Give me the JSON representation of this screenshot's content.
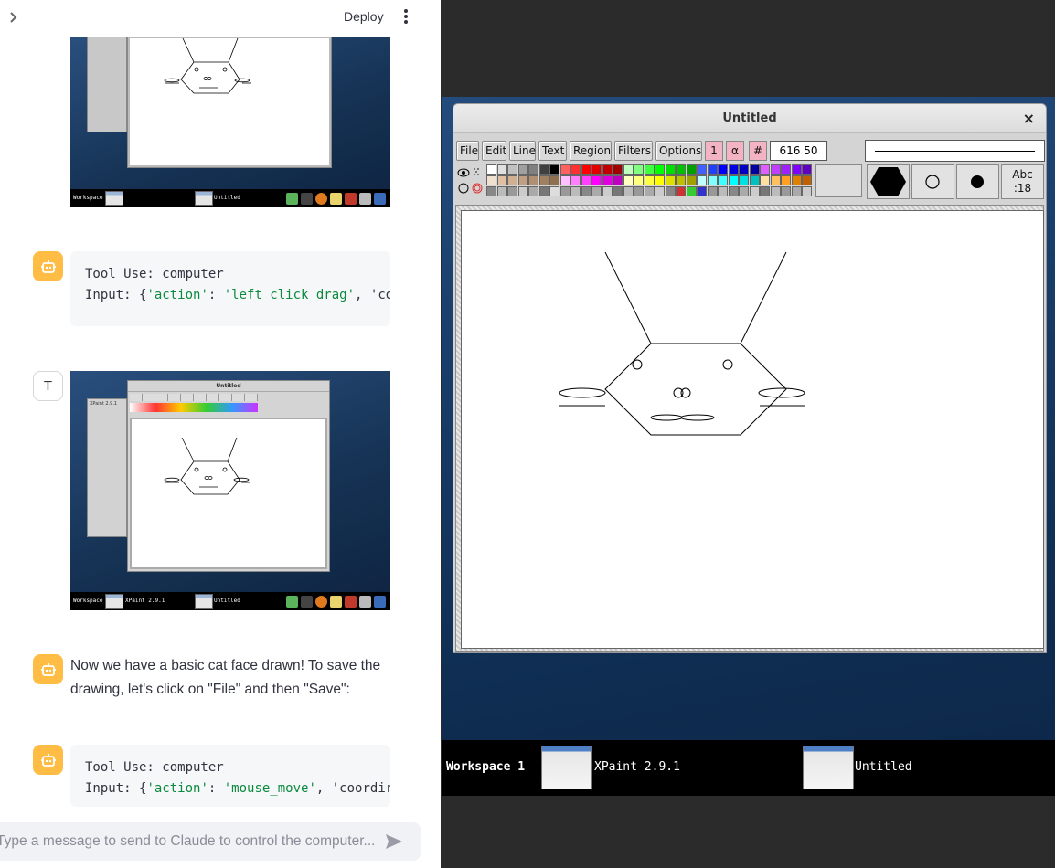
{
  "header": {
    "deploy_label": "Deploy"
  },
  "chat": {
    "tool_use_1": {
      "line1": "Tool Use: computer",
      "line2_prefix": "Input: {",
      "line2_key": "'action'",
      "line2_sep": ": ",
      "line2_val": "'left_click_drag'",
      "line2_rest": ", 'co"
    },
    "user_avatar": "T",
    "message_1": "Now we have a basic cat face drawn! To save the drawing, let's click on \"File\" and then \"Save\":",
    "tool_use_2": {
      "line1": "Tool Use: computer",
      "line2_prefix": "Input: {",
      "line2_key": "'action'",
      "line2_sep": ": ",
      "line2_val": "'mouse_move'",
      "line2_rest": ", 'coordir"
    },
    "input_placeholder": "Type a message to send to Claude to control the computer..."
  },
  "thumb_shots": {
    "taskbar_workspace": "Workspace 1",
    "taskbar_app": "XPaint 2.9.1",
    "taskbar_window": "Untitled",
    "mini_title": "Untitled",
    "mini_app": "XPaint 2.9.1"
  },
  "xpaint": {
    "window_title": "Untitled",
    "close_glyph": "×",
    "menus": [
      "File",
      "Edit",
      "Line",
      "Text",
      "Region",
      "Filters",
      "Options"
    ],
    "pink_buttons": [
      "1",
      "α",
      "#"
    ],
    "coords": "616 50",
    "font_box": "Abc\n:18",
    "font_line1": "Abc",
    "font_line2": ":18"
  },
  "taskbar": {
    "workspace": "Workspace 1",
    "app1": "XPaint 2.9.1",
    "app2": "Untitled"
  },
  "colors": {
    "accent_avatar": "#ffbd45",
    "code_string": "#0b8a3e",
    "pink_button": "#f4b3c2"
  }
}
